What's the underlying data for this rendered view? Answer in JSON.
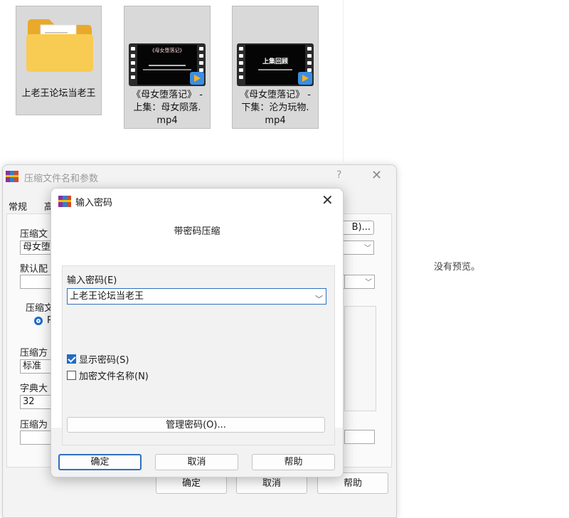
{
  "explorer": {
    "files": [
      {
        "name": "上老王论坛当老王",
        "type": "folder"
      },
      {
        "name": "《母女堕落记》 - 上集：母女陨落. mp4",
        "type": "video",
        "thumb_title": "《母女堕落记》"
      },
      {
        "name": "《母女堕落记》 - 下集：沦为玩物. mp4",
        "type": "video",
        "thumb_title": "上集回顾"
      }
    ],
    "preview_text": "没有预览。"
  },
  "background_dialog": {
    "title": "压缩文件名和参数",
    "help": "?",
    "close": "✕",
    "tabs": [
      "常规",
      "高"
    ],
    "labels": {
      "archive_name": "压缩文",
      "default_profile": "默认配",
      "archive_format": "压缩文",
      "method": "压缩方",
      "dictionary": "字典大",
      "split": "压缩为"
    },
    "values": {
      "archive_name": "母女堕",
      "method": "标准",
      "dictionary": "32",
      "browse_suffix": "B)..."
    },
    "radio_label": "R",
    "buttons": {
      "ok": "确定",
      "cancel": "取消",
      "help": "帮助"
    }
  },
  "password_dialog": {
    "title": "输入密码",
    "close": "✕",
    "header": "带密码压缩",
    "password_label": "输入密码(E)",
    "password_value": "上老王论坛当老王",
    "show_password": {
      "label": "显示密码(S)",
      "checked": true
    },
    "encrypt_names": {
      "label": "加密文件名称(N)",
      "checked": false
    },
    "manage_button": "管理密码(O)...",
    "buttons": {
      "ok": "确定",
      "cancel": "取消",
      "help": "帮助"
    }
  },
  "colors": {
    "accent": "#1e6bc9",
    "tile_bg": "#d9d9d9",
    "folder": "#f6c343"
  }
}
